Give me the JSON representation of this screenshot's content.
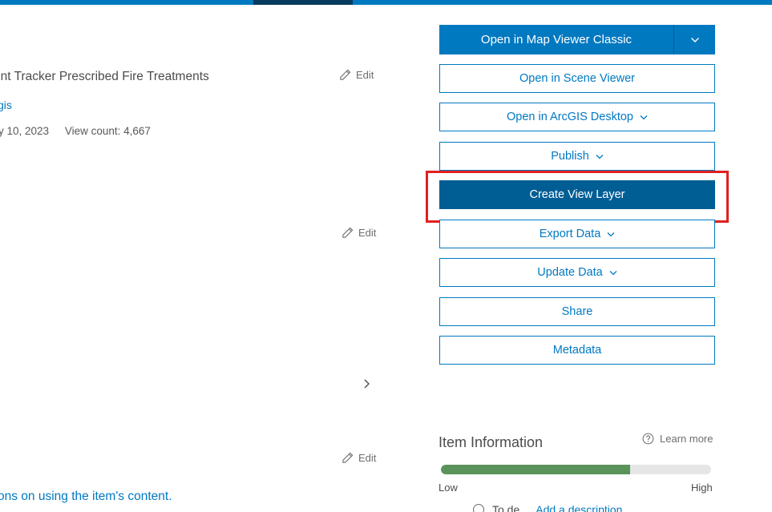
{
  "item": {
    "title": "ent Tracker Prescribed Fire Treatments",
    "owner": "gis",
    "date": "y 10, 2023",
    "view_count": "View count: 4,667",
    "description_link": "ons on using the item's content."
  },
  "edit_label": "Edit",
  "actions": {
    "open_map_viewer_classic": "Open in Map Viewer Classic",
    "open_scene_viewer": "Open in Scene Viewer",
    "open_arcgis_desktop": "Open in ArcGIS Desktop",
    "publish": "Publish",
    "create_view_layer": "Create View Layer",
    "export_data": "Export Data",
    "update_data": "Update Data",
    "share": "Share",
    "metadata": "Metadata"
  },
  "item_information": {
    "heading": "Item Information",
    "learn_more": "Learn more",
    "progress": 0.7,
    "low": "Low",
    "high": "High",
    "partial_text": "To de",
    "partial_link": "Add a description"
  },
  "colors": {
    "brand": "#0079c1",
    "brand_dark": "#005e95",
    "highlight": "#e02020",
    "progress_fill": "#5a9359"
  }
}
